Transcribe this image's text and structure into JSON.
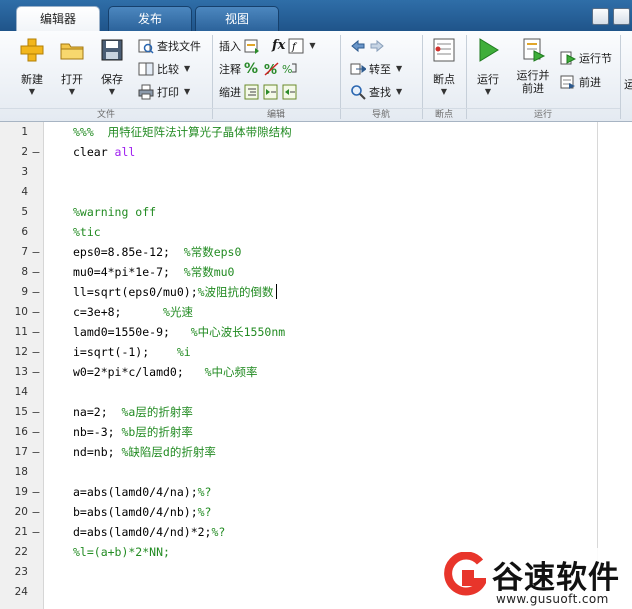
{
  "tabs": [
    {
      "label": "编辑器",
      "active": true
    },
    {
      "label": "发布",
      "active": false
    },
    {
      "label": "视图",
      "active": false
    }
  ],
  "ribbon": {
    "file": {
      "new_label": "新建",
      "open_label": "打开",
      "save_label": "保存",
      "find_files_label": "查找文件",
      "compare_label": "比较",
      "print_label": "打印",
      "group_label": "文件"
    },
    "edit": {
      "insert_label": "插入",
      "comment_label": "注释",
      "indent_label": "缩进",
      "fx_label": "fx",
      "percent_label": "%",
      "group_label": "编辑"
    },
    "navigate": {
      "goto_label": "转至",
      "find_label": "查找",
      "group_label": "导航"
    },
    "breakpoints": {
      "breakpoints_label": "断点",
      "group_label": "断点"
    },
    "run": {
      "run_label": "运行",
      "run_advance_label_1": "运行并",
      "run_advance_label_2": "前进",
      "run_section_label": "运行节",
      "advance_label": "前进",
      "group_label": "运行",
      "cut_label": "运"
    }
  },
  "editor": {
    "lines": [
      {
        "num": "1",
        "mark": "",
        "code": "%%%  用特征矩阵法计算光子晶体带隙结构",
        "type": "comment"
      },
      {
        "num": "2",
        "mark": "–",
        "code": "clear ",
        "kw": "all",
        "type": "kw"
      },
      {
        "num": "3",
        "mark": "",
        "code": "",
        "type": "plain"
      },
      {
        "num": "4",
        "mark": "",
        "code": "",
        "type": "plain"
      },
      {
        "num": "5",
        "mark": "",
        "code": "%warning off",
        "type": "comment"
      },
      {
        "num": "6",
        "mark": "",
        "code": "%tic",
        "type": "comment"
      },
      {
        "num": "7",
        "mark": "–",
        "code": "eps0=8.85e-12;  ",
        "cmt": "%常数eps0",
        "type": "mixed"
      },
      {
        "num": "8",
        "mark": "–",
        "code": "mu0=4*pi*1e-7;  ",
        "cmt": "%常数mu0",
        "type": "mixed"
      },
      {
        "num": "9",
        "mark": "–",
        "code": "ll=sqrt(eps0/mu0);",
        "cmt": "%波阻抗的倒数",
        "type": "mixed",
        "cursor": true
      },
      {
        "num": "10",
        "mark": "–",
        "code": "c=3e+8;      ",
        "cmt": "%光速",
        "type": "mixed"
      },
      {
        "num": "11",
        "mark": "–",
        "code": "lamd0=1550e-9;   ",
        "cmt": "%中心波长1550nm",
        "type": "mixed"
      },
      {
        "num": "12",
        "mark": "–",
        "code": "i=sqrt(-1);    ",
        "cmt": "%i",
        "type": "mixed"
      },
      {
        "num": "13",
        "mark": "–",
        "code": "w0=2*pi*c/lamd0;   ",
        "cmt": "%中心频率",
        "type": "mixed"
      },
      {
        "num": "14",
        "mark": "",
        "code": "",
        "type": "plain"
      },
      {
        "num": "15",
        "mark": "–",
        "code": "na=2;  ",
        "cmt": "%a层的折射率",
        "type": "mixed"
      },
      {
        "num": "16",
        "mark": "–",
        "code": "nb=-3; ",
        "cmt": "%b层的折射率",
        "type": "mixed"
      },
      {
        "num": "17",
        "mark": "–",
        "code": "nd=nb; ",
        "cmt": "%缺陷层d的折射率",
        "type": "mixed"
      },
      {
        "num": "18",
        "mark": "",
        "code": "",
        "type": "plain"
      },
      {
        "num": "19",
        "mark": "–",
        "code": "a=abs(lamd0/4/na);",
        "cmt": "%?",
        "type": "mixed"
      },
      {
        "num": "20",
        "mark": "–",
        "code": "b=abs(lamd0/4/nb);",
        "cmt": "%?",
        "type": "mixed"
      },
      {
        "num": "21",
        "mark": "–",
        "code": "d=abs(lamd0/4/nd)*2;",
        "cmt": "%?",
        "type": "mixed"
      },
      {
        "num": "22",
        "mark": "",
        "code": "%l=(a+b)*2*NN;",
        "type": "comment"
      },
      {
        "num": "23",
        "mark": "",
        "code": "",
        "type": "plain"
      },
      {
        "num": "24",
        "mark": "",
        "code": "",
        "type": "plain"
      }
    ]
  },
  "watermark": {
    "name": "谷速软件",
    "url": "www.gusuoft.com"
  },
  "colors": {
    "comment": "#228b22",
    "keyword": "#a020f0",
    "tab_bar": "#2f6ea8",
    "logo_red": "#e8352b"
  }
}
